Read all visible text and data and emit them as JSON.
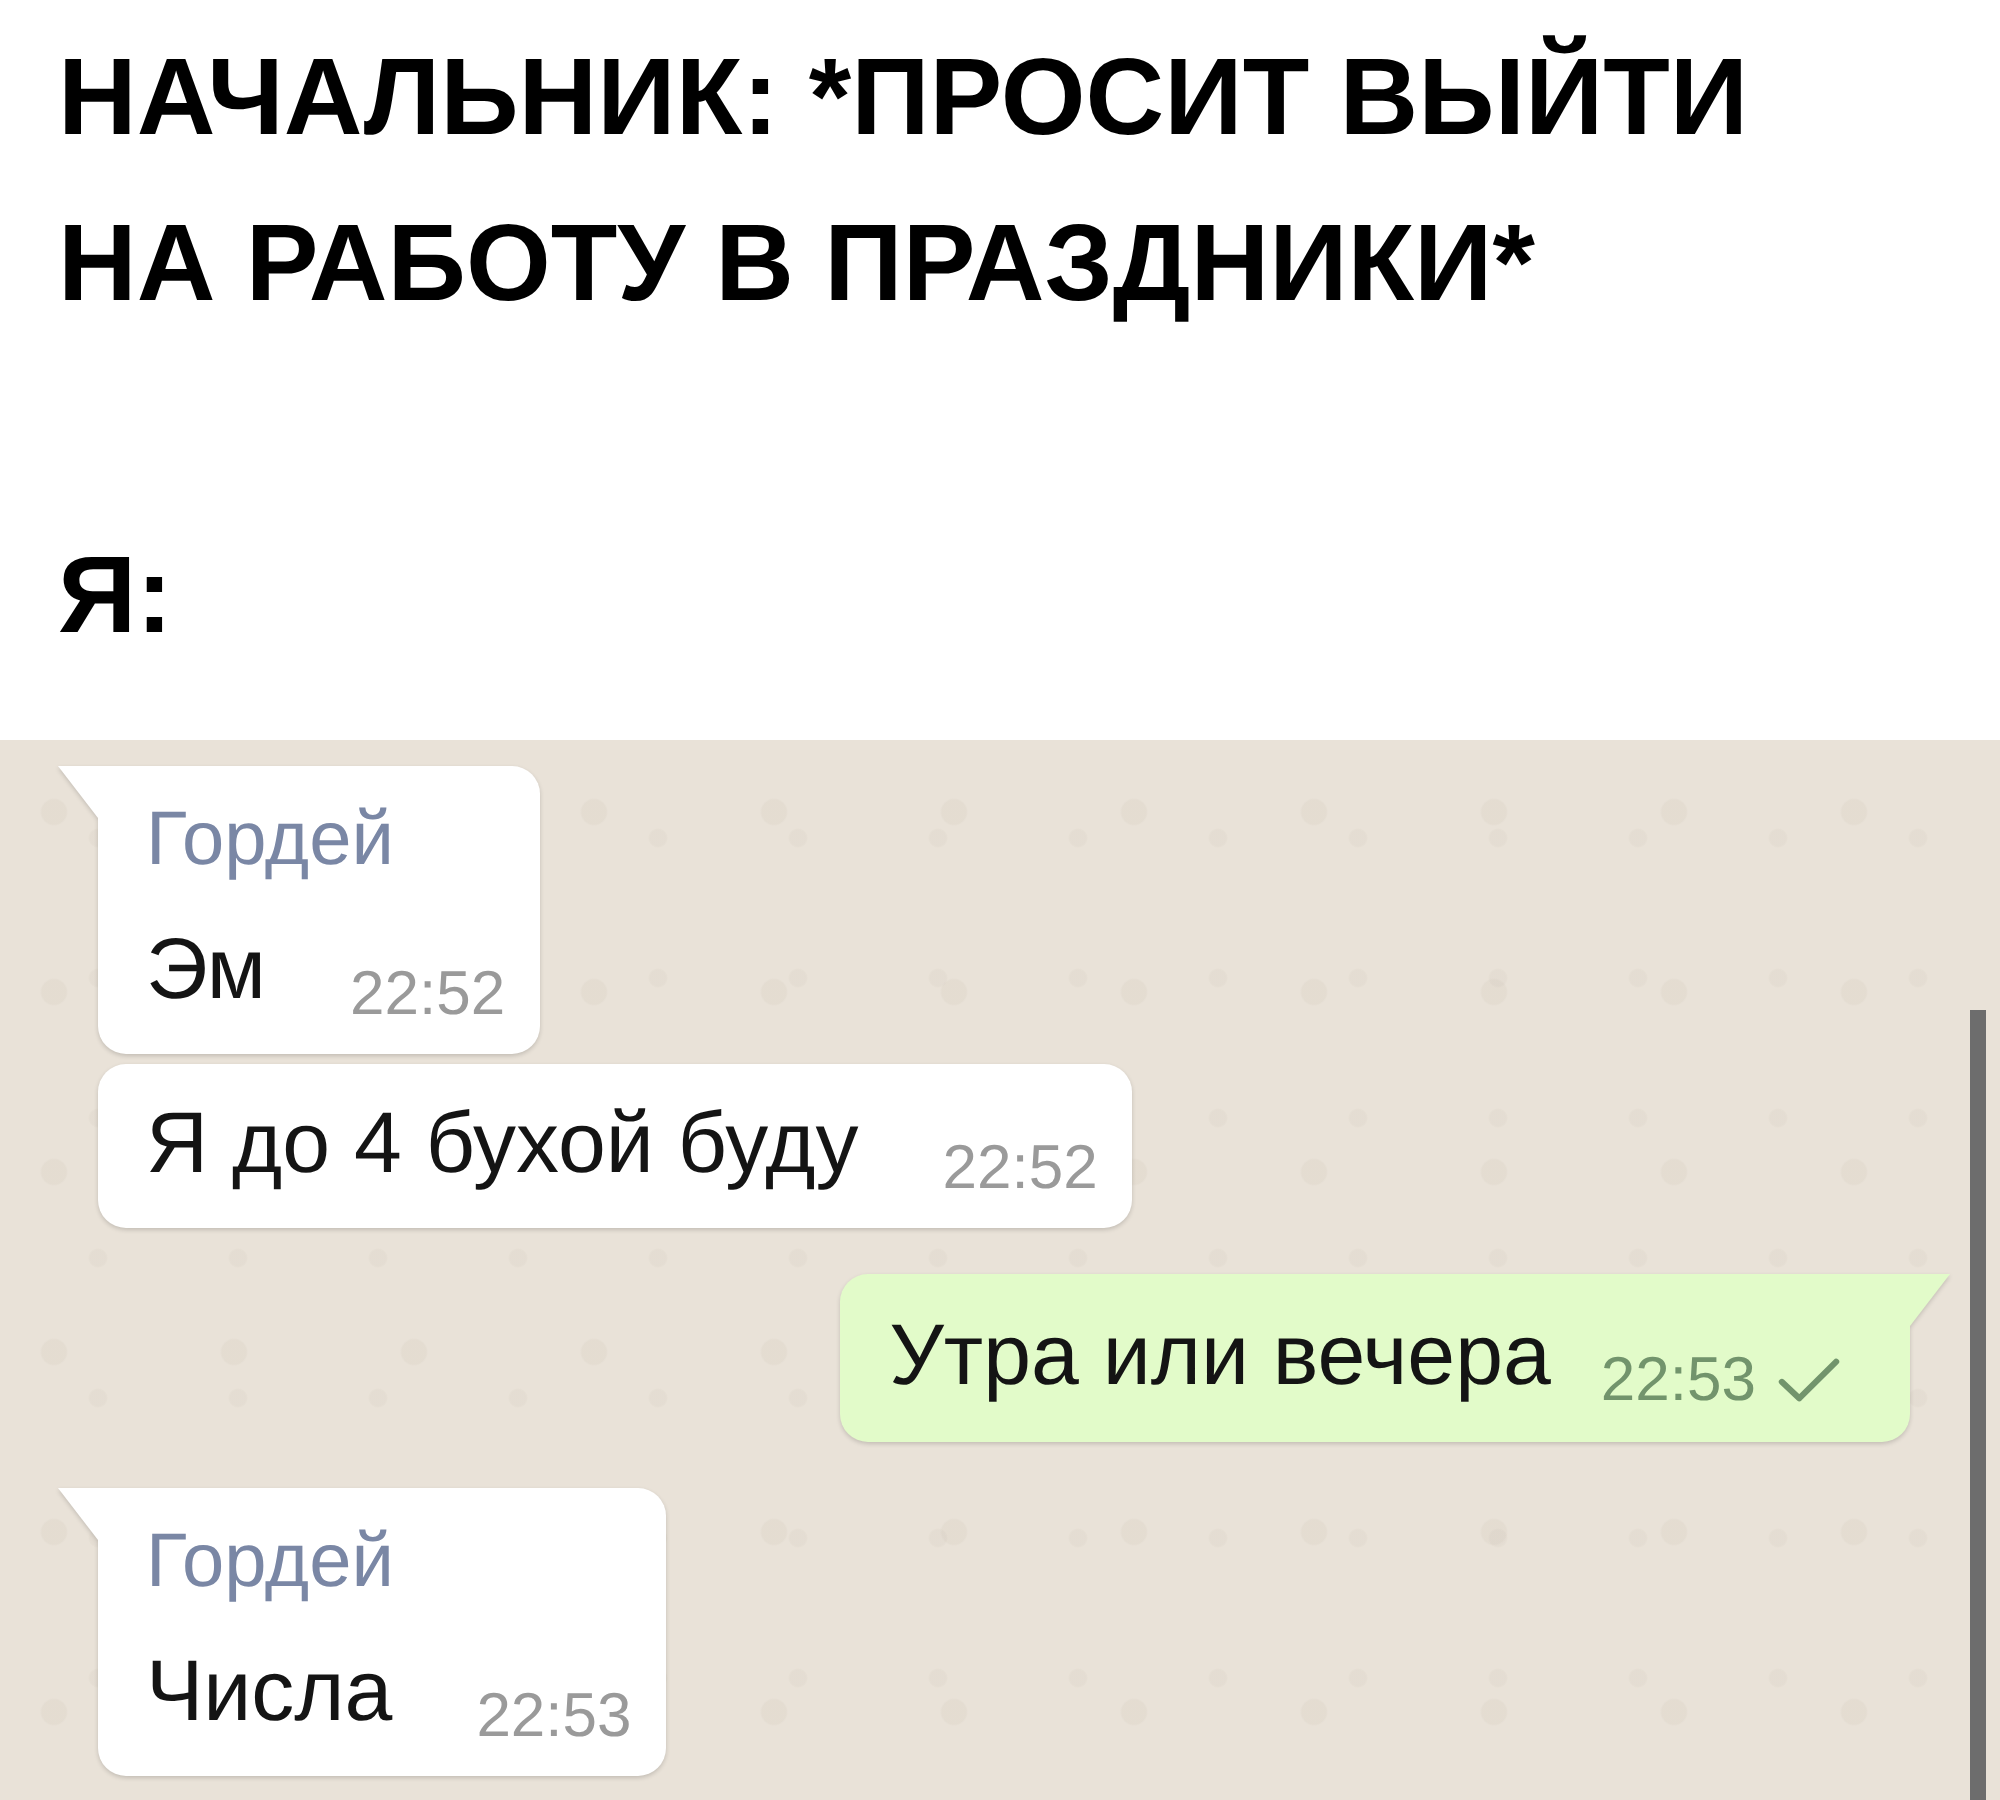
{
  "caption": {
    "text": "НАЧАЛЬНИК: *ПРОСИТ ВЫЙТИ\nНА РАБОТУ В ПРАЗДНИКИ*",
    "reply_label": "Я:"
  },
  "chat": {
    "messages": [
      {
        "kind": "incoming",
        "tail": true,
        "sender": "Гордей",
        "text": "Эм",
        "time": "22:52"
      },
      {
        "kind": "incoming",
        "tail": false,
        "text": "Я до 4 бухой буду",
        "time": "22:52"
      },
      {
        "kind": "outgoing",
        "tail": true,
        "text": "Утра или вечера",
        "time": "22:53",
        "sent": true
      },
      {
        "kind": "incoming",
        "tail": true,
        "sender": "Гордей",
        "text": "Числа",
        "time": "22:53"
      }
    ]
  }
}
